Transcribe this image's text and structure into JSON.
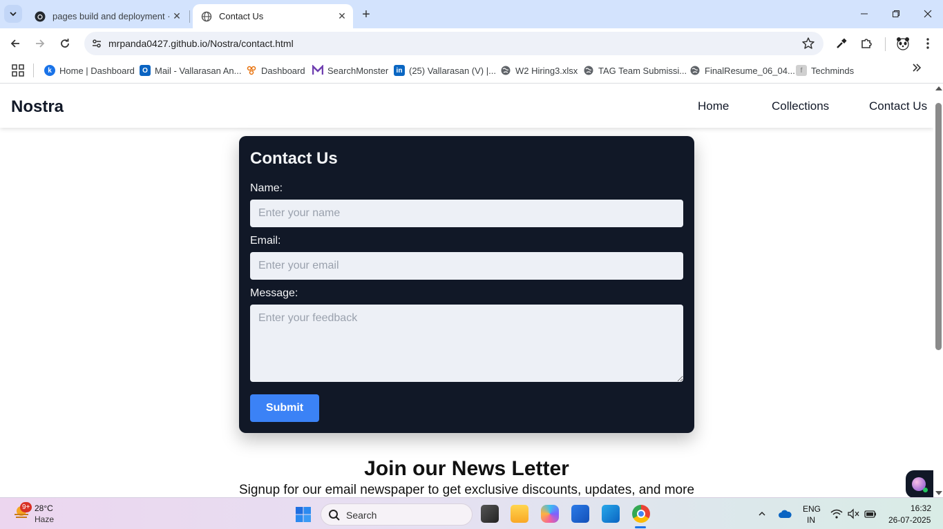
{
  "browser": {
    "tabs": [
      {
        "title": "pages build and deployment · M",
        "active": false
      },
      {
        "title": "Contact Us",
        "active": true
      }
    ],
    "url": "mrpanda0427.github.io/Nostra/contact.html",
    "bookmarks": [
      {
        "label": "Home | Dashboard",
        "icon": "k-logo-icon",
        "color": "#1a73e8"
      },
      {
        "label": "Mail - Vallarasan An...",
        "icon": "outlook-icon",
        "color": "#0a64c2"
      },
      {
        "label": "Dashboard",
        "icon": "people-icon",
        "color": "#e8710a"
      },
      {
        "label": "SearchMonster",
        "icon": "searchmonster-icon",
        "color": "#6f3fb0"
      },
      {
        "label": "(25) Vallarasan (V) |...",
        "icon": "linkedin-icon",
        "color": "#0a66c2"
      },
      {
        "label": "W2 Hiring3.xlsx",
        "icon": "globe-icon",
        "color": "#5f6368"
      },
      {
        "label": "TAG Team Submissi...",
        "icon": "globe-icon",
        "color": "#5f6368"
      },
      {
        "label": "FinalResume_06_04...",
        "icon": "globe-icon",
        "color": "#5f6368"
      },
      {
        "label": "Techminds",
        "icon": "folder-icon",
        "color": "#bdbdbd"
      }
    ]
  },
  "site": {
    "brand": "Nostra",
    "nav": [
      "Home",
      "Collections",
      "Contact Us"
    ],
    "contact": {
      "title": "Contact Us",
      "name_label": "Name:",
      "name_placeholder": "Enter your name",
      "email_label": "Email:",
      "email_placeholder": "Enter your email",
      "message_label": "Message:",
      "message_placeholder": "Enter your feedback",
      "submit_label": "Submit"
    },
    "newsletter": {
      "title": "Join our News Letter",
      "subtitle": "Signup for our email newspaper to get exclusive discounts, updates, and more"
    },
    "colors": {
      "card": "#111827",
      "accent": "#3b82f6"
    }
  },
  "taskbar": {
    "weather_badge": "9+",
    "temperature": "28°C",
    "condition": "Haze",
    "search_label": "Search",
    "lang_line1": "ENG",
    "lang_line2": "IN",
    "time": "16:32",
    "date": "26-07-2025"
  }
}
